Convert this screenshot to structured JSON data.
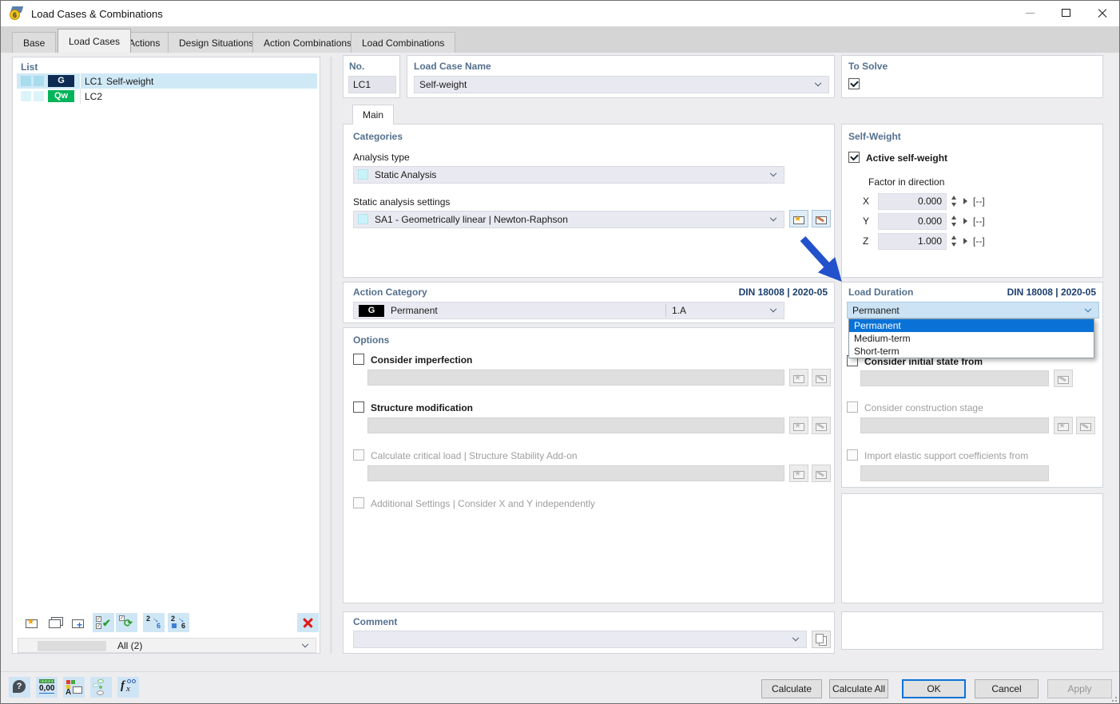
{
  "window": {
    "title": "Load Cases & Combinations",
    "icon_text": "6"
  },
  "tabs": {
    "items": [
      "Base",
      "Load Cases",
      "Actions",
      "Design Situations",
      "Action Combinations",
      "Load Combinations"
    ],
    "active": "Load Cases"
  },
  "list_panel": {
    "header": "List",
    "rows": [
      {
        "id": "LC1",
        "name": "Self-weight",
        "badge": "G"
      },
      {
        "id": "LC2",
        "name": "",
        "badge": "Qw"
      }
    ],
    "filter_value": "All (2)",
    "toolbar": {
      "renumber_from": "2",
      "renumber_to": "6"
    }
  },
  "header_fields": {
    "no_label": "No.",
    "no_value": "LC1",
    "name_label": "Load Case Name",
    "name_value": "Self-weight",
    "to_solve_label": "To Solve"
  },
  "main_panel": {
    "tab": "Main",
    "categories": {
      "header": "Categories",
      "analysis_type_label": "Analysis type",
      "analysis_type_value": "Static Analysis",
      "settings_label": "Static analysis settings",
      "settings_value": "SA1 - Geometrically linear | Newton-Raphson"
    },
    "action_category": {
      "header": "Action Category",
      "standard": "DIN 18008 | 2020-05",
      "badge": "G",
      "value": "Permanent",
      "combination": "1.A"
    },
    "options": {
      "header": "Options",
      "consider_imperfection": "Consider imperfection",
      "structure_modification": "Structure modification",
      "critical_load": "Calculate critical load | Structure Stability Add-on",
      "additional_settings": "Additional Settings | Consider X and Y independently"
    },
    "comment_header": "Comment"
  },
  "right_panel": {
    "self_weight": {
      "header": "Self-Weight",
      "active_label": "Active self-weight",
      "factor_label": "Factor in direction",
      "factors": [
        {
          "axis": "X",
          "value": "0.000",
          "unit": "[--]"
        },
        {
          "axis": "Y",
          "value": "0.000",
          "unit": "[--]"
        },
        {
          "axis": "Z",
          "value": "1.000",
          "unit": "[--]"
        }
      ]
    },
    "load_duration": {
      "header": "Load Duration",
      "standard": "DIN 18008 | 2020-05",
      "value": "Permanent",
      "options": [
        "Permanent",
        "Medium-term",
        "Short-term"
      ]
    },
    "extra_options": {
      "initial_state": "Consider initial state from",
      "construction_stage": "Consider construction stage",
      "elastic_support": "Import elastic support coefficients from"
    }
  },
  "footer": {
    "units_icon_text": "0,00",
    "buttons": {
      "calculate": "Calculate",
      "calculate_all": "Calculate All",
      "ok": "OK",
      "cancel": "Cancel",
      "apply": "Apply"
    }
  },
  "colors": {
    "accent_blue": "#0a72d7",
    "header_text": "#54708e",
    "standard_text": "#1c3f6e",
    "badge_g_dark": "#0e2c53",
    "badge_g_black": "#000000",
    "badge_qw_green": "#00b45a",
    "selection_bg": "#cfe9f6",
    "arrow_blue": "#2351cb"
  }
}
